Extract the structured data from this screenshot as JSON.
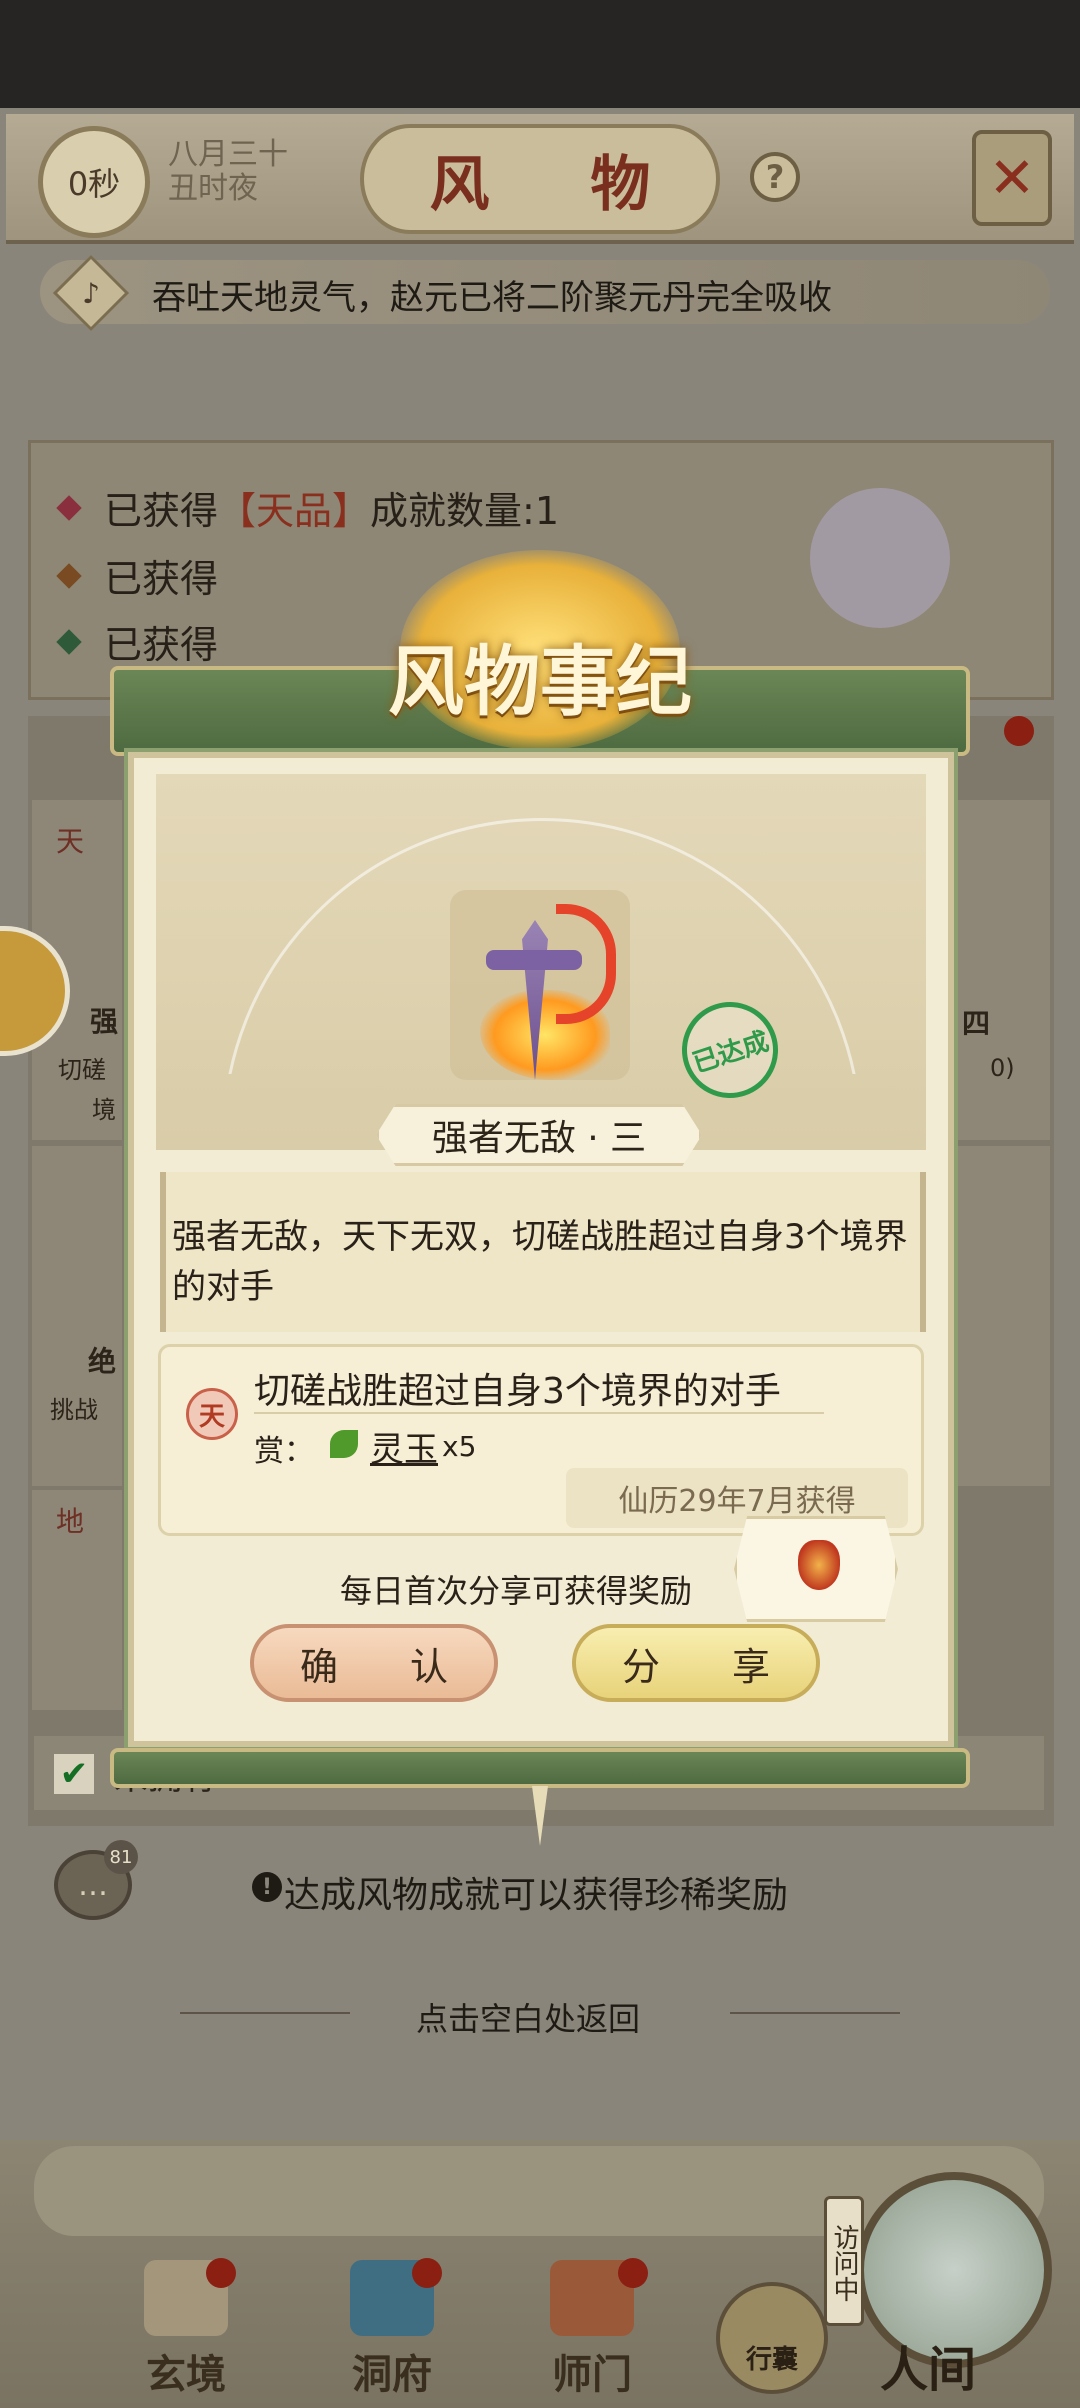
{
  "header": {
    "timer": "0秒",
    "date_line1": "八月三十",
    "date_line2": "丑时夜",
    "title": "风 物",
    "help": "?"
  },
  "notice": {
    "text": "吞吐天地灵气，赵元已将二阶聚元丹完全吸收"
  },
  "stats": {
    "row1_prefix": "已获得",
    "row1_grade": "【天品】",
    "row1_suffix": "成就数量:1",
    "row2_prefix": "已获得",
    "row3_prefix": "已获得"
  },
  "background_list": {
    "left_card1_char": "天",
    "left_card1_name": "强",
    "left_card1_sub1": "切磋",
    "left_card1_sub2": "境",
    "right_card1_name": "四",
    "right_card1_sub": "0)",
    "left_card2_name": "绝",
    "left_card2_sub": "挑战",
    "left_card3_char": "地",
    "filter_label": "未拥有"
  },
  "modal": {
    "title": "风物事纪",
    "achievement_name": "强者无敌 · 三",
    "stamp": "已达成",
    "description": "强者无敌，天下无双，切磋战胜超过自身3个境界的对手",
    "condition_badge": "天",
    "condition": "切磋战胜超过自身3个境界的对手",
    "reward_label": "赏：",
    "reward_name": "灵玉",
    "reward_qty": "x5",
    "obtained_date": "仙历29年7月获得",
    "share_hint": "每日首次分享可获得奖励",
    "confirm_button": "确 认",
    "share_button": "分 享"
  },
  "footer": {
    "note": "达成风物成就可以获得珍稀奖励",
    "chat_count": "81",
    "return_hint": "点击空白处返回"
  },
  "nav": {
    "items": [
      {
        "label": "玄境"
      },
      {
        "label": "洞府"
      },
      {
        "label": "师门"
      },
      {
        "label": "行囊"
      }
    ],
    "visit_tag": "访问中",
    "world_label": "人间"
  },
  "colors": {
    "accent_red": "#8a2f1e",
    "frame_green": "#4e6a40",
    "stamp_green": "#2f9a4a",
    "parchment": "#f2ecd4"
  }
}
